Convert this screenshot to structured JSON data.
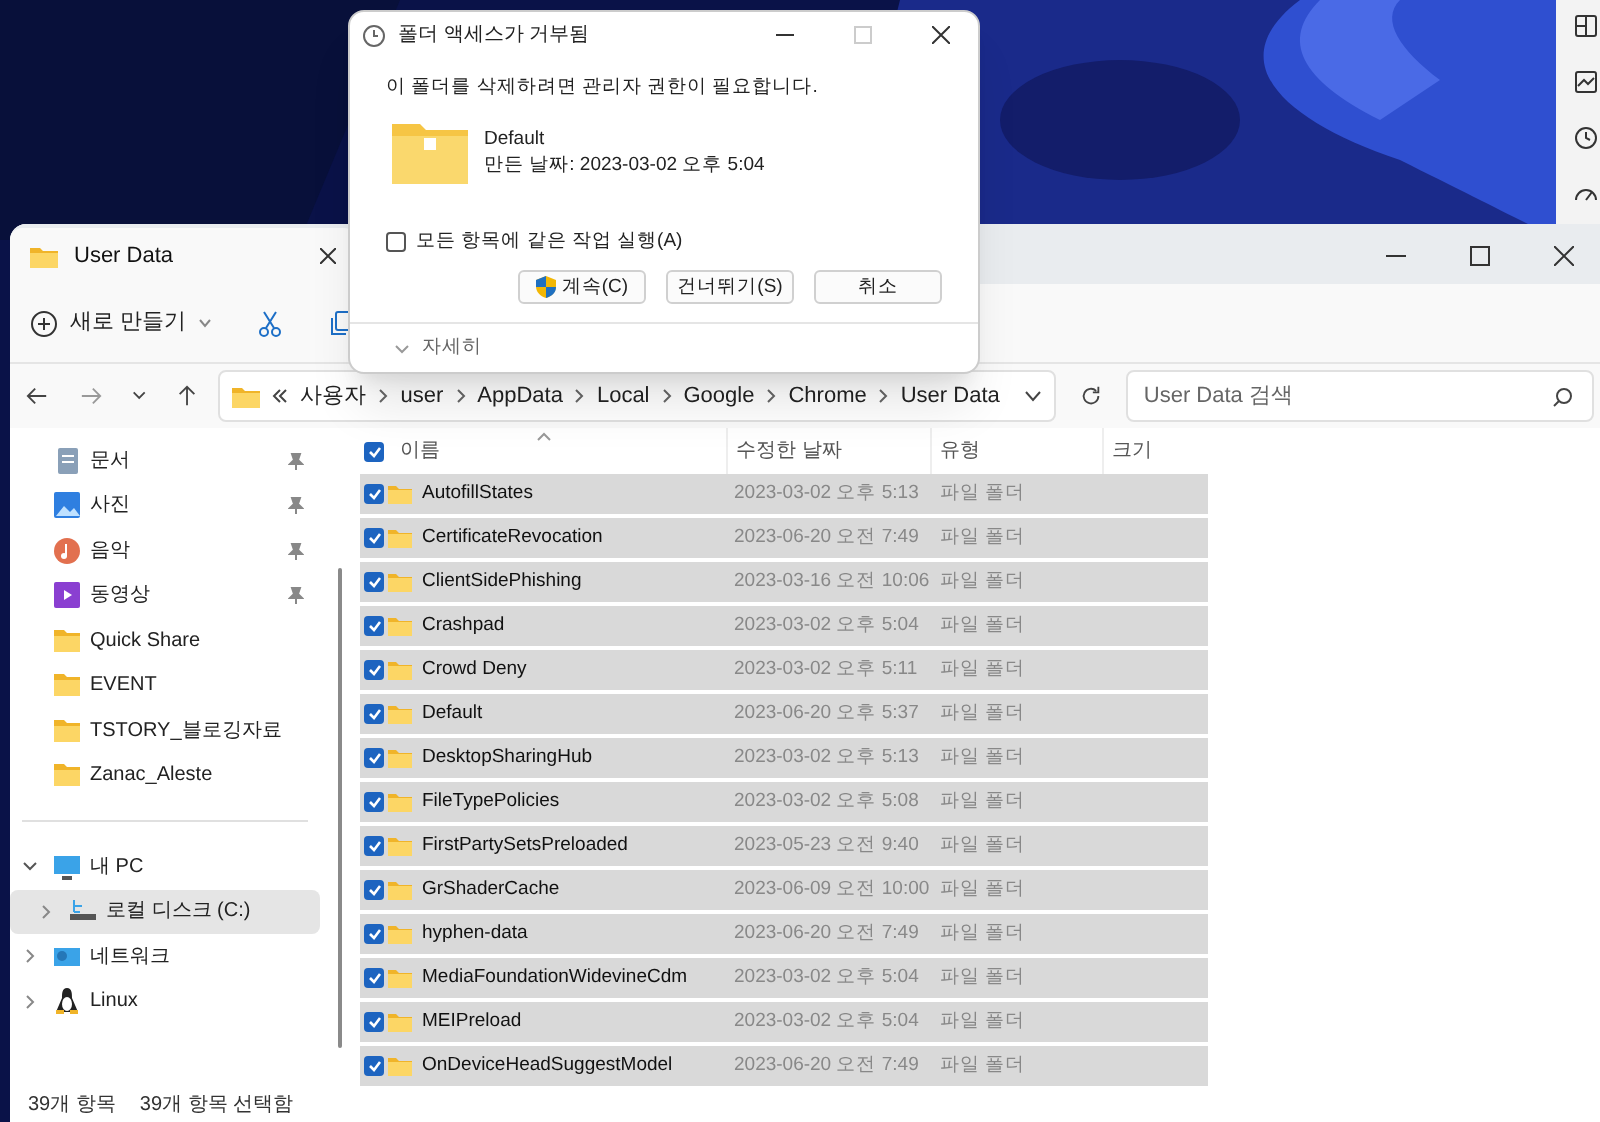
{
  "explorer": {
    "tab": {
      "label": "User Data",
      "selected": true
    },
    "toolbar": {
      "new_label": "새로 만들기"
    },
    "address": {
      "crumbs": [
        "사용자",
        "user",
        "AppData",
        "Local",
        "Google",
        "Chrome",
        "User Data"
      ]
    },
    "search": {
      "placeholder": "User Data 검색"
    },
    "sidebar": {
      "quick_access": [
        {
          "label": "문서",
          "kind": "documents",
          "pinned": true
        },
        {
          "label": "사진",
          "kind": "pictures",
          "pinned": true
        },
        {
          "label": "음악",
          "kind": "music",
          "pinned": true
        },
        {
          "label": "동영상",
          "kind": "videos",
          "pinned": true
        },
        {
          "label": "Quick Share",
          "kind": "folder",
          "pinned": false
        },
        {
          "label": "EVENT",
          "kind": "folder",
          "pinned": false
        },
        {
          "label": "TSTORY_블로깅자료",
          "kind": "folder",
          "pinned": false
        },
        {
          "label": "Zanac_Aleste",
          "kind": "folder",
          "pinned": false
        }
      ],
      "tree": [
        {
          "label": "내 PC",
          "kind": "pc",
          "expanded": true,
          "selected": false,
          "children": [
            {
              "label": "로컬 디스크 (C:)",
              "kind": "drive",
              "expanded": false,
              "selected": true
            }
          ]
        },
        {
          "label": "네트워크",
          "kind": "network",
          "expanded": false,
          "selected": false
        },
        {
          "label": "Linux",
          "kind": "linux",
          "expanded": false,
          "selected": false
        }
      ]
    },
    "table": {
      "all_checked": true,
      "columns": [
        {
          "label": "이름",
          "sorted": true
        },
        {
          "label": "수정한 날짜"
        },
        {
          "label": "유형"
        },
        {
          "label": "크기"
        }
      ],
      "rows": [
        {
          "name": "AutofillStates",
          "date": "2023-03-02 오후 5:13",
          "type": "파일 폴더",
          "selected": true
        },
        {
          "name": "CertificateRevocation",
          "date": "2023-06-20 오전 7:49",
          "type": "파일 폴더",
          "selected": true
        },
        {
          "name": "ClientSidePhishing",
          "date": "2023-03-16 오전 10:06",
          "type": "파일 폴더",
          "selected": true
        },
        {
          "name": "Crashpad",
          "date": "2023-03-02 오후 5:04",
          "type": "파일 폴더",
          "selected": true
        },
        {
          "name": "Crowd Deny",
          "date": "2023-03-02 오후 5:11",
          "type": "파일 폴더",
          "selected": true
        },
        {
          "name": "Default",
          "date": "2023-06-20 오후 5:37",
          "type": "파일 폴더",
          "selected": true
        },
        {
          "name": "DesktopSharingHub",
          "date": "2023-03-02 오후 5:13",
          "type": "파일 폴더",
          "selected": true
        },
        {
          "name": "FileTypePolicies",
          "date": "2023-03-02 오후 5:08",
          "type": "파일 폴더",
          "selected": true
        },
        {
          "name": "FirstPartySetsPreloaded",
          "date": "2023-05-23 오전 9:40",
          "type": "파일 폴더",
          "selected": true
        },
        {
          "name": "GrShaderCache",
          "date": "2023-06-09 오전 10:00",
          "type": "파일 폴더",
          "selected": true
        },
        {
          "name": "hyphen-data",
          "date": "2023-06-20 오전 7:49",
          "type": "파일 폴더",
          "selected": true
        },
        {
          "name": "MediaFoundationWidevineCdm",
          "date": "2023-03-02 오후 5:04",
          "type": "파일 폴더",
          "selected": true
        },
        {
          "name": "MEIPreload",
          "date": "2023-03-02 오후 5:04",
          "type": "파일 폴더",
          "selected": true
        },
        {
          "name": "OnDeviceHeadSuggestModel",
          "date": "2023-06-20 오전 7:49",
          "type": "파일 폴더",
          "selected": true
        }
      ]
    },
    "status_bar": [
      "39개 항목",
      "39개 항목 선택함"
    ]
  },
  "dialog": {
    "title": "폴더 액세스가 거부됨",
    "message": "이 폴더를 삭제하려면 관리자 권한이 필요합니다.",
    "item_name": "Default",
    "item_detail": "만든 날짜: 2023-03-02 오후 5:04",
    "apply_all": {
      "label": "모든 항목에 같은 작업 실행(A)",
      "checked": false
    },
    "buttons": [
      {
        "label": "계속(C)",
        "kind": "shield"
      },
      {
        "label": "건너뛰기(S)",
        "kind": "plain"
      },
      {
        "label": "취소",
        "kind": "plain"
      }
    ],
    "details": "자세히"
  }
}
